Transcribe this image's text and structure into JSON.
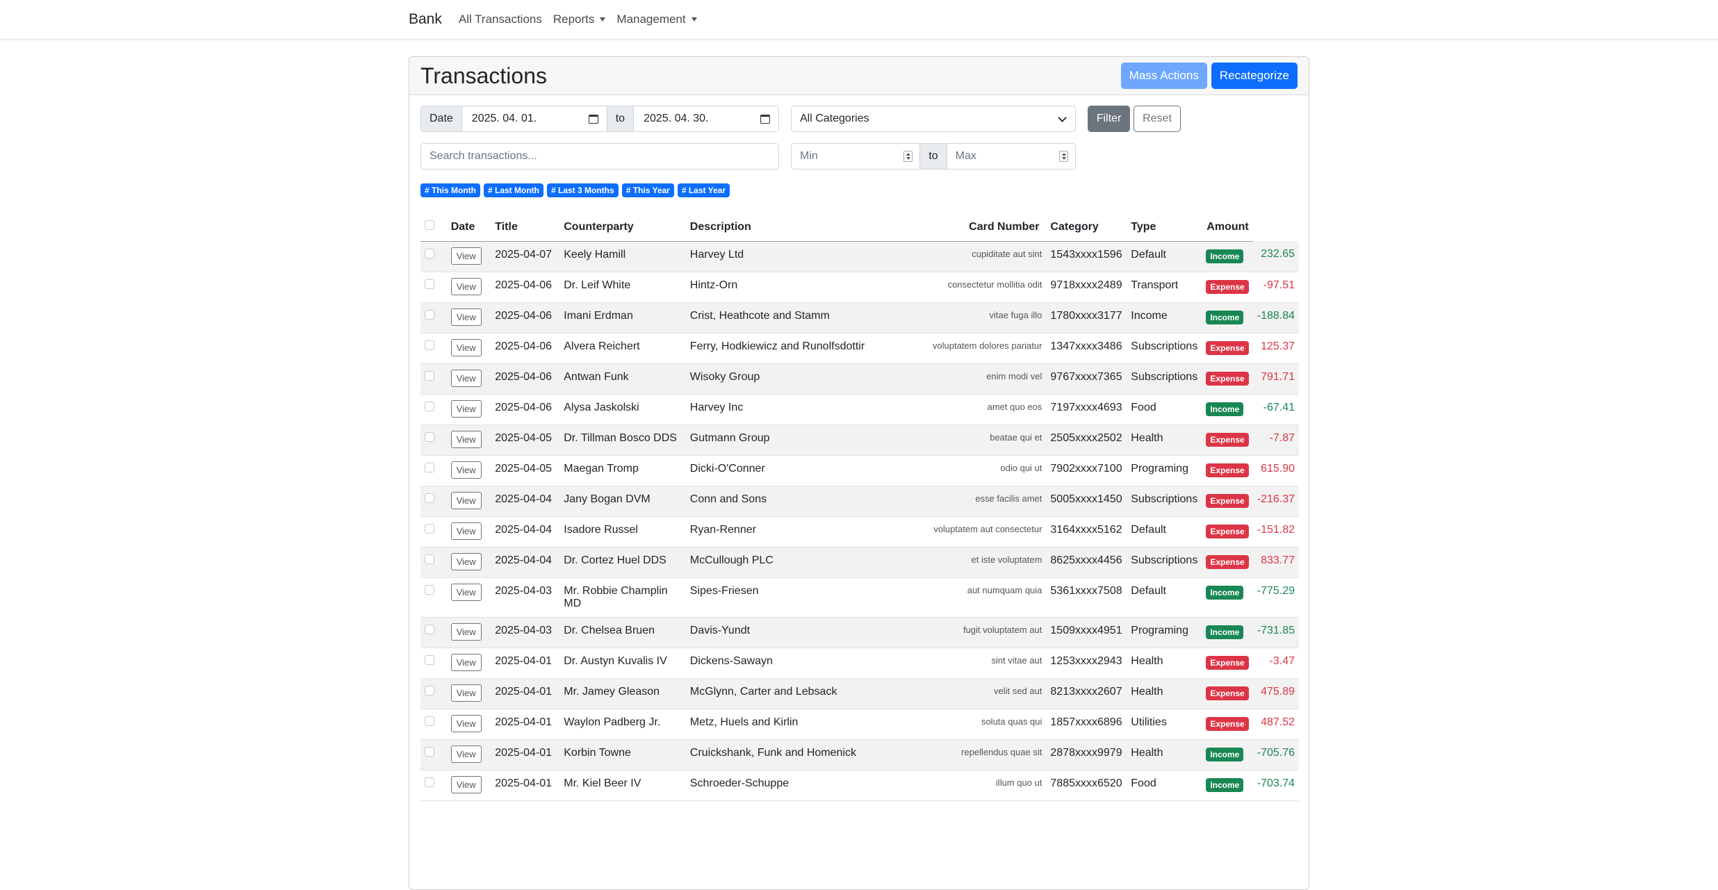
{
  "nav": {
    "brand": "Bank",
    "all_transactions": "All Transactions",
    "reports": "Reports",
    "management": "Management"
  },
  "header": {
    "title": "Transactions",
    "mass_actions": "Mass Actions",
    "recategorize": "Recategorize"
  },
  "filters": {
    "date_label": "Date",
    "date_from": "2025. 04. 01.",
    "to_label": "to",
    "date_to": "2025. 04. 30.",
    "category": "All Categories",
    "filter_btn": "Filter",
    "reset_btn": "Reset",
    "search_placeholder": "Search transactions...",
    "min_placeholder": "Min",
    "max_placeholder": "Max",
    "amount_to": "to"
  },
  "chips": [
    "# This Month",
    "# Last Month",
    "# Last 3 Months",
    "# This Year",
    "# Last Year"
  ],
  "table": {
    "headers": {
      "date": "Date",
      "title": "Title",
      "counterparty": "Counterparty",
      "description": "Description",
      "card": "Card Number",
      "category": "Category",
      "type": "Type",
      "amount": "Amount"
    },
    "view_label": "View",
    "rows": [
      {
        "date": "2025-04-07",
        "title": "Keely Hamill",
        "counterparty": "Harvey Ltd",
        "description": "cupiditate aut sint",
        "card": "1543xxxx1596",
        "category": "Default",
        "type": "Income",
        "amount": "232.65"
      },
      {
        "date": "2025-04-06",
        "title": "Dr. Leif White",
        "counterparty": "Hintz-Orn",
        "description": "consectetur mollitia odit",
        "card": "9718xxxx2489",
        "category": "Transport",
        "type": "Expense",
        "amount": "-97.51"
      },
      {
        "date": "2025-04-06",
        "title": "Imani Erdman",
        "counterparty": "Crist, Heathcote and Stamm",
        "description": "vitae fuga illo",
        "card": "1780xxxx3177",
        "category": "Income",
        "type": "Income",
        "amount": "-188.84"
      },
      {
        "date": "2025-04-06",
        "title": "Alvera Reichert",
        "counterparty": "Ferry, Hodkiewicz and Runolfsdottir",
        "description": "voluptatem dolores pariatur",
        "card": "1347xxxx3486",
        "category": "Subscriptions",
        "type": "Expense",
        "amount": "125.37"
      },
      {
        "date": "2025-04-06",
        "title": "Antwan Funk",
        "counterparty": "Wisoky Group",
        "description": "enim modi vel",
        "card": "9767xxxx7365",
        "category": "Subscriptions",
        "type": "Expense",
        "amount": "791.71"
      },
      {
        "date": "2025-04-06",
        "title": "Alysa Jaskolski",
        "counterparty": "Harvey Inc",
        "description": "amet quo eos",
        "card": "7197xxxx4693",
        "category": "Food",
        "type": "Income",
        "amount": "-67.41"
      },
      {
        "date": "2025-04-05",
        "title": "Dr. Tillman Bosco DDS",
        "counterparty": "Gutmann Group",
        "description": "beatae qui et",
        "card": "2505xxxx2502",
        "category": "Health",
        "type": "Expense",
        "amount": "-7.87"
      },
      {
        "date": "2025-04-05",
        "title": "Maegan Tromp",
        "counterparty": "Dicki-O'Conner",
        "description": "odio qui ut",
        "card": "7902xxxx7100",
        "category": "Programing",
        "type": "Expense",
        "amount": "615.90"
      },
      {
        "date": "2025-04-04",
        "title": "Jany Bogan DVM",
        "counterparty": "Conn and Sons",
        "description": "esse facilis amet",
        "card": "5005xxxx1450",
        "category": "Subscriptions",
        "type": "Expense",
        "amount": "-216.37"
      },
      {
        "date": "2025-04-04",
        "title": "Isadore Russel",
        "counterparty": "Ryan-Renner",
        "description": "voluptatem aut consectetur",
        "card": "3164xxxx5162",
        "category": "Default",
        "type": "Expense",
        "amount": "-151.82"
      },
      {
        "date": "2025-04-04",
        "title": "Dr. Cortez Huel DDS",
        "counterparty": "McCullough PLC",
        "description": "et iste voluptatem",
        "card": "8625xxxx4456",
        "category": "Subscriptions",
        "type": "Expense",
        "amount": "833.77"
      },
      {
        "date": "2025-04-03",
        "title": "Mr. Robbie Champlin MD",
        "counterparty": "Sipes-Friesen",
        "description": "aut numquam quia",
        "card": "5361xxxx7508",
        "category": "Default",
        "type": "Income",
        "amount": "-775.29"
      },
      {
        "date": "2025-04-03",
        "title": "Dr. Chelsea Bruen",
        "counterparty": "Davis-Yundt",
        "description": "fugit voluptatem aut",
        "card": "1509xxxx4951",
        "category": "Programing",
        "type": "Income",
        "amount": "-731.85"
      },
      {
        "date": "2025-04-01",
        "title": "Dr. Austyn Kuvalis IV",
        "counterparty": "Dickens-Sawayn",
        "description": "sint vitae aut",
        "card": "1253xxxx2943",
        "category": "Health",
        "type": "Expense",
        "amount": "-3.47"
      },
      {
        "date": "2025-04-01",
        "title": "Mr. Jamey Gleason",
        "counterparty": "McGlynn, Carter and Lebsack",
        "description": "velit sed aut",
        "card": "8213xxxx2607",
        "category": "Health",
        "type": "Expense",
        "amount": "475.89"
      },
      {
        "date": "2025-04-01",
        "title": "Waylon Padberg Jr.",
        "counterparty": "Metz, Huels and Kirlin",
        "description": "soluta quas qui",
        "card": "1857xxxx6896",
        "category": "Utilities",
        "type": "Expense",
        "amount": "487.52"
      },
      {
        "date": "2025-04-01",
        "title": "Korbin Towne",
        "counterparty": "Cruickshank, Funk and Homenick",
        "description": "repellendus quae sit",
        "card": "2878xxxx9979",
        "category": "Health",
        "type": "Income",
        "amount": "-705.76"
      },
      {
        "date": "2025-04-01",
        "title": "Mr. Kiel Beer IV",
        "counterparty": "Schroeder-Schuppe",
        "description": "illum quo ut",
        "card": "7885xxxx6520",
        "category": "Food",
        "type": "Income",
        "amount": "-703.74"
      }
    ]
  }
}
